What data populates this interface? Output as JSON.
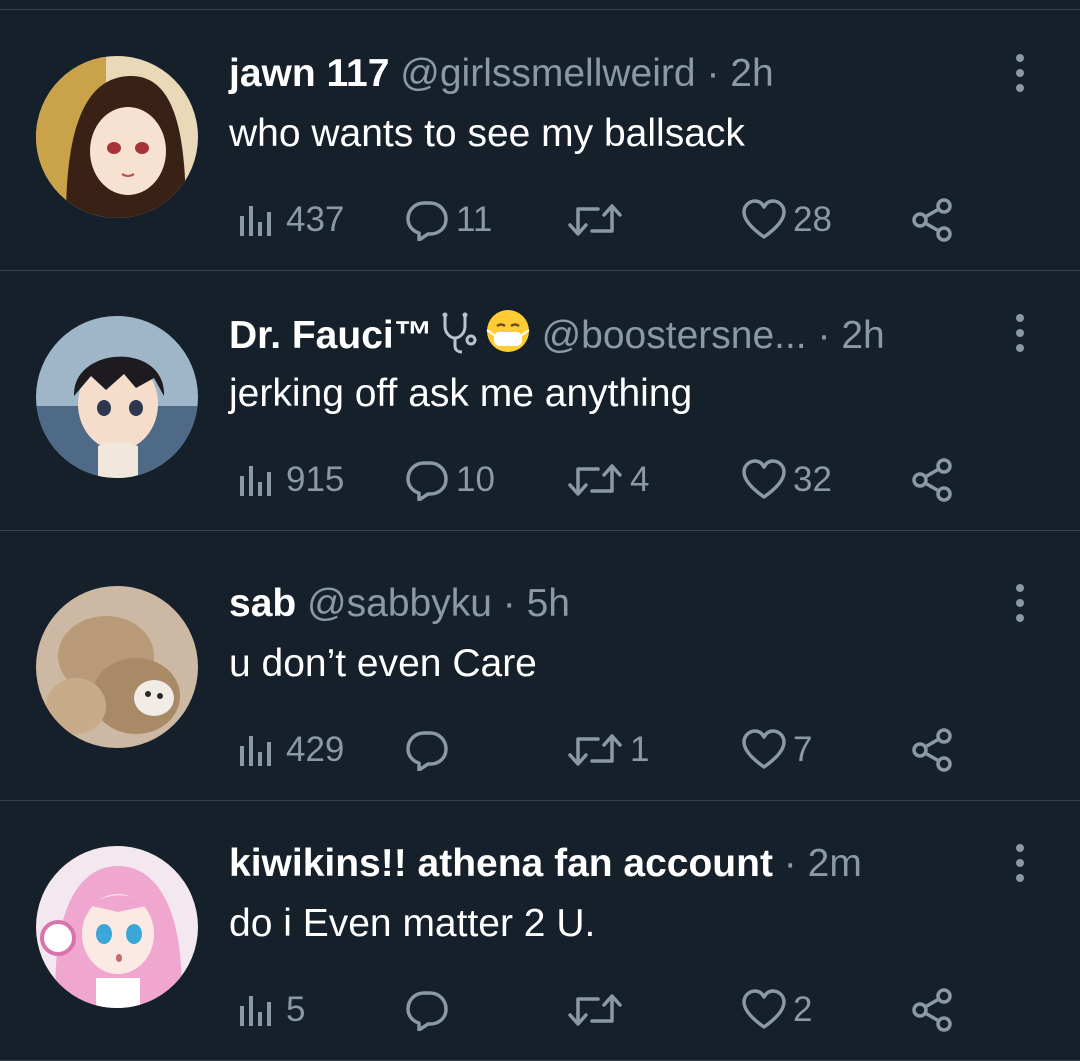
{
  "colors": {
    "background": "#15202b",
    "divider": "#38444d",
    "muted": "#8b98a5",
    "text": "#ffffff"
  },
  "tweets": [
    {
      "name": "jawn 117",
      "handle": "@girlssmellweird",
      "dot": "·",
      "time": "2h",
      "text": "who wants to see my ballsack",
      "views": "437",
      "replies": "11",
      "retweets": "",
      "likes": "28",
      "name_icons": []
    },
    {
      "name": "Dr. Fauci™",
      "handle": "@boostersne...",
      "dot": "·",
      "time": "2h",
      "text": "jerking off ask me anything",
      "views": "915",
      "replies": "10",
      "retweets": "4",
      "likes": "32",
      "name_icons": [
        "stethoscope-emoji",
        "mask-face-emoji"
      ]
    },
    {
      "name": "sab",
      "handle": "@sabbyku",
      "dot": "·",
      "time": "5h",
      "text": "u don’t even Care",
      "views": "429",
      "replies": "",
      "retweets": "1",
      "likes": "7",
      "name_icons": []
    },
    {
      "name": "kiwikins!! athena fan account",
      "handle": "",
      "dot": "·",
      "time": "2m",
      "text": "do i Even matter 2 U.",
      "views": "5",
      "replies": "",
      "retweets": "",
      "likes": "2",
      "name_icons": []
    }
  ]
}
